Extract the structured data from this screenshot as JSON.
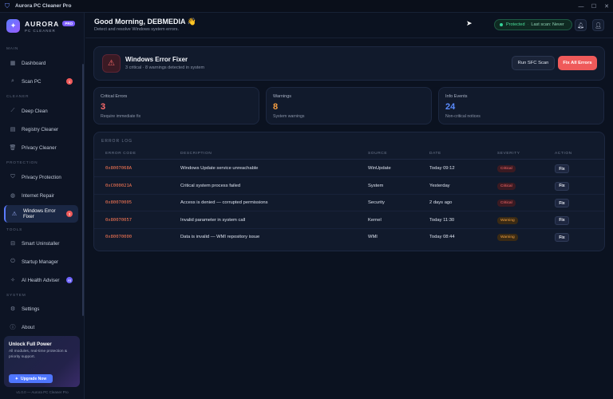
{
  "window": {
    "title": "Aurora PC Cleaner Pro"
  },
  "brand": {
    "name": "AURORA",
    "badge": "PRO",
    "subtitle": "PC CLEANER"
  },
  "sidebar": {
    "sections": [
      "MAIN",
      "CLEANER",
      "PROTECTION",
      "TOOLS",
      "SYSTEM"
    ],
    "items": [
      {
        "label": "Dashboard",
        "icon": "grid-icon"
      },
      {
        "label": "Scan PC",
        "icon": "search-icon",
        "badge": "1"
      },
      {
        "label": "Deep Clean",
        "icon": "broom-icon"
      },
      {
        "label": "Registry Cleaner",
        "icon": "document-icon"
      },
      {
        "label": "Privacy Cleaner",
        "icon": "trash-icon"
      },
      {
        "label": "Privacy Protection",
        "icon": "shield-icon"
      },
      {
        "label": "Internet Repair",
        "icon": "globe-icon"
      },
      {
        "label": "Windows Error Fixer",
        "icon": "warning-icon",
        "badge": "3",
        "active": true
      },
      {
        "label": "Smart Uninstaller",
        "icon": "uninstall-icon"
      },
      {
        "label": "Startup Manager",
        "icon": "power-icon"
      },
      {
        "label": "AI Health Adviser",
        "icon": "ai-icon",
        "badge": "AI"
      },
      {
        "label": "Settings",
        "icon": "gear-icon"
      },
      {
        "label": "About",
        "icon": "info-icon"
      }
    ],
    "upgrade": {
      "title": "Unlock Full Power",
      "description": "All modules, real-time protection & priority support.",
      "button": "Upgrade Now"
    },
    "version": "v1.0.0 — Aurora PC Cleaner Pro"
  },
  "header": {
    "greeting": "Good Morning, DEBMEDIA 👋",
    "subtitle": "Detect and resolve Windows system errors.",
    "status": {
      "protected": "Protected",
      "separator": "·",
      "last_scan": "Last scan: Never"
    }
  },
  "fixer": {
    "title": "Windows Error Fixer",
    "subtitle": "3 critical · 8 warnings detected in system",
    "sfc_button": "Run SFC Scan",
    "fix_all_button": "Fix All Errors"
  },
  "stats": [
    {
      "label": "Critical Errors",
      "value": "3",
      "desc": "Require immediate fix",
      "color": "#ff6b6b"
    },
    {
      "label": "Warnings",
      "value": "8",
      "desc": "System warnings",
      "color": "#f59e42"
    },
    {
      "label": "Info Events",
      "value": "24",
      "desc": "Non-critical notices",
      "color": "#5b8cff"
    }
  ],
  "error_log": {
    "title": "ERROR LOG",
    "columns": [
      "ERROR CODE",
      "DESCRIPTION",
      "SOURCE",
      "DATE",
      "SEVERITY",
      "ACTION"
    ],
    "rows": [
      {
        "code": "0x8007068A",
        "description": "Windows Update service unreachable",
        "source": "WinUpdate",
        "date": "Today 09:12",
        "severity": "Critical",
        "action": "Fix"
      },
      {
        "code": "0xC000021A",
        "description": "Critical system process failed",
        "source": "System",
        "date": "Yesterday",
        "severity": "Critical",
        "action": "Fix"
      },
      {
        "code": "0x80070005",
        "description": "Access is denied — corrupted permissions",
        "source": "Security",
        "date": "2 days ago",
        "severity": "Critical",
        "action": "Fix"
      },
      {
        "code": "0x80070057",
        "description": "Invalid parameter in system call",
        "source": "Kernel",
        "date": "Today 11:30",
        "severity": "Warning",
        "action": "Fix"
      },
      {
        "code": "0x80070000",
        "description": "Data is invalid — WMI repository issue",
        "source": "WMI",
        "date": "Today 08:44",
        "severity": "Warning",
        "action": "Fix"
      }
    ]
  }
}
